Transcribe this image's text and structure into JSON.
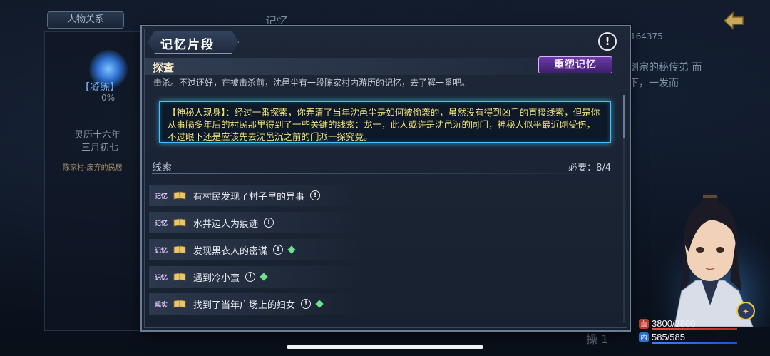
{
  "background": {
    "tab_label": "人物关系",
    "memory_title": "记忆",
    "cultivate_label": "【凝练】",
    "cultivate_pct": "0%",
    "date_line1": "灵历十六年",
    "date_line2": "三月初七",
    "location": "陈家村-废弃的民居",
    "number": "164375",
    "side_text": "剑宗的秘传弟 而下，一发而",
    "bottom_num": "操 1"
  },
  "dialog": {
    "title": "记忆片段",
    "info_icon": "exclamation-icon",
    "section_title": "探查",
    "rebuild_label": "重塑记忆",
    "intro": "击杀。不过还好，在被击杀前，沈邑尘有一段陈家村内游历的记忆，去了解一番吧。",
    "hint": "【神秘人现身】：经过一番探索，你弄清了当年沈邑尘是如何被偷袭的，虽然没有得到凶手的直接线索，但是你从事隔多年后的村民那里得到了一些关键的线索：龙一，此人或许是沈邑沉的同门，神秘人似乎最近刚受伤，不过眼下还是应该先去沈邑沉之前的门派一探究竟。",
    "clues_label": "线索",
    "clues_count": "必要：8/4",
    "clues": [
      {
        "tag": "记忆",
        "text": "有村民发现了村子里的异事",
        "diamond": false
      },
      {
        "tag": "记忆",
        "text": "水井边人为痕迹",
        "diamond": false
      },
      {
        "tag": "记忆",
        "text": "发现黑衣人的密谋",
        "diamond": true
      },
      {
        "tag": "记忆",
        "text": "遇到冷小蛮",
        "diamond": true
      },
      {
        "tag": "现实",
        "text": "找到了当年广场上的妇女",
        "diamond": true
      }
    ]
  },
  "character": {
    "hp": "3800/3800",
    "mp": "585/585",
    "hp_icon_label": "血",
    "mp_icon_label": "内"
  },
  "colors": {
    "hint_border": "#3ec3ff",
    "hint_text": "#f1e27a",
    "rebuild_bg": "#6a3aa8",
    "diamond": "#6fe08a"
  }
}
